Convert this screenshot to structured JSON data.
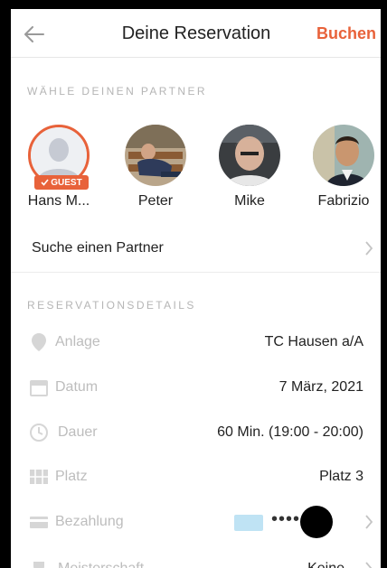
{
  "header": {
    "title": "Deine Reservation",
    "action_label": "Buchen"
  },
  "partners_section": {
    "label": "WÄHLE DEINEN PARTNER",
    "guest_badge": "GUEST",
    "partners": [
      {
        "name": "Hans M..."
      },
      {
        "name": "Peter"
      },
      {
        "name": "Mike"
      },
      {
        "name": "Fabrizio"
      }
    ],
    "search_label": "Suche einen Partner"
  },
  "details_section": {
    "label": "RESERVATIONSDETAILS",
    "rows": [
      {
        "label": "Anlage",
        "value": "TC Hausen a/A",
        "icon": "location-pin-icon"
      },
      {
        "label": "Datum",
        "value": "7 März, 2021",
        "icon": "calendar-icon"
      },
      {
        "label": "Dauer",
        "value": "60 Min. (19:00 - 20:00)",
        "icon": "clock-icon"
      },
      {
        "label": "Platz",
        "value": "Platz 3",
        "icon": "court-grid-icon"
      },
      {
        "label": "Bezahlung",
        "value": "••••",
        "icon": "credit-card-icon"
      },
      {
        "label": "Meisterschaft",
        "value": "Keine",
        "icon": "trophy-icon"
      }
    ]
  },
  "colors": {
    "accent": "#e8623a",
    "muted_text": "#bdbdbd",
    "section_label": "#b5b5b5",
    "divider": "#ececec"
  }
}
